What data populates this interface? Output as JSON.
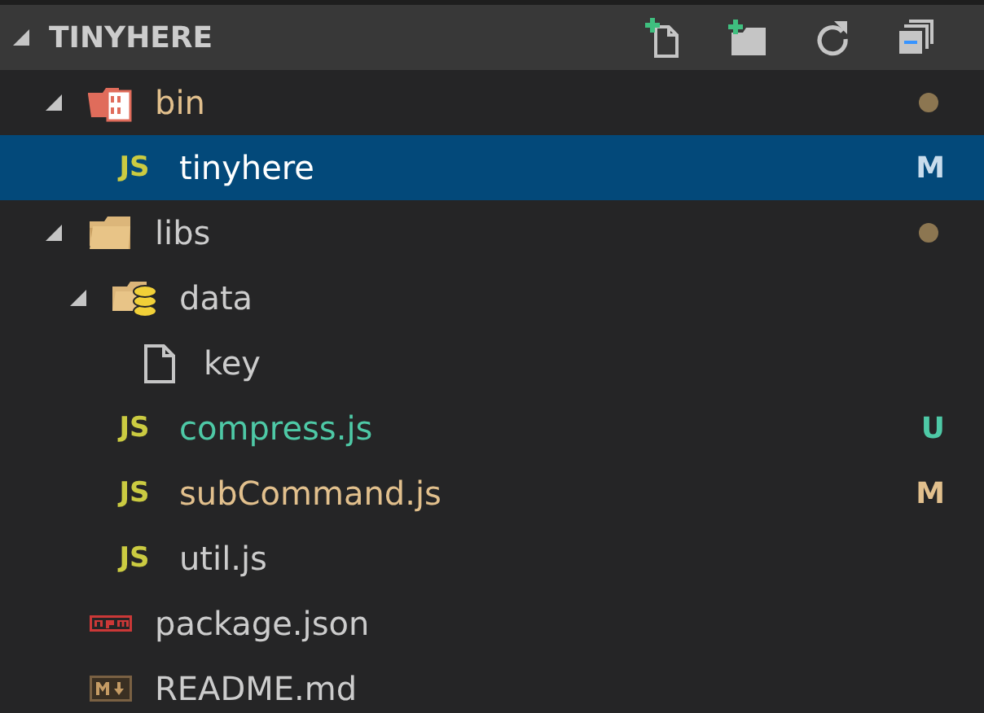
{
  "explorer": {
    "title": "TINYHERE",
    "expanded": true
  },
  "tree": [
    {
      "label": "bin",
      "kind": "folder-binary",
      "expanded": true,
      "selected": false,
      "modified": true,
      "untracked": false,
      "dot": true,
      "children": [
        {
          "label": "tinyhere",
          "kind": "js",
          "icon_text": "JS",
          "selected": true,
          "modified": true,
          "untracked": false,
          "badge": "M"
        }
      ]
    },
    {
      "label": "libs",
      "kind": "folder",
      "expanded": true,
      "selected": false,
      "modified": false,
      "untracked": false,
      "dot": true,
      "children": [
        {
          "label": "data",
          "kind": "folder-data",
          "expanded": true,
          "selected": false,
          "modified": false,
          "untracked": false,
          "children": [
            {
              "label": "key",
              "kind": "file",
              "selected": false,
              "modified": false,
              "untracked": false
            }
          ]
        },
        {
          "label": "compress.js",
          "kind": "js",
          "icon_text": "JS",
          "selected": false,
          "modified": false,
          "untracked": true,
          "badge": "U"
        },
        {
          "label": "subCommand.js",
          "kind": "js",
          "icon_text": "JS",
          "selected": false,
          "modified": true,
          "untracked": false,
          "badge": "M"
        },
        {
          "label": "util.js",
          "kind": "js",
          "icon_text": "JS",
          "selected": false,
          "modified": false,
          "untracked": false
        }
      ]
    },
    {
      "label": "package.json",
      "kind": "npm",
      "selected": false,
      "modified": false,
      "untracked": false
    },
    {
      "label": "README.md",
      "kind": "markdown",
      "selected": false,
      "modified": false,
      "untracked": false
    }
  ]
}
